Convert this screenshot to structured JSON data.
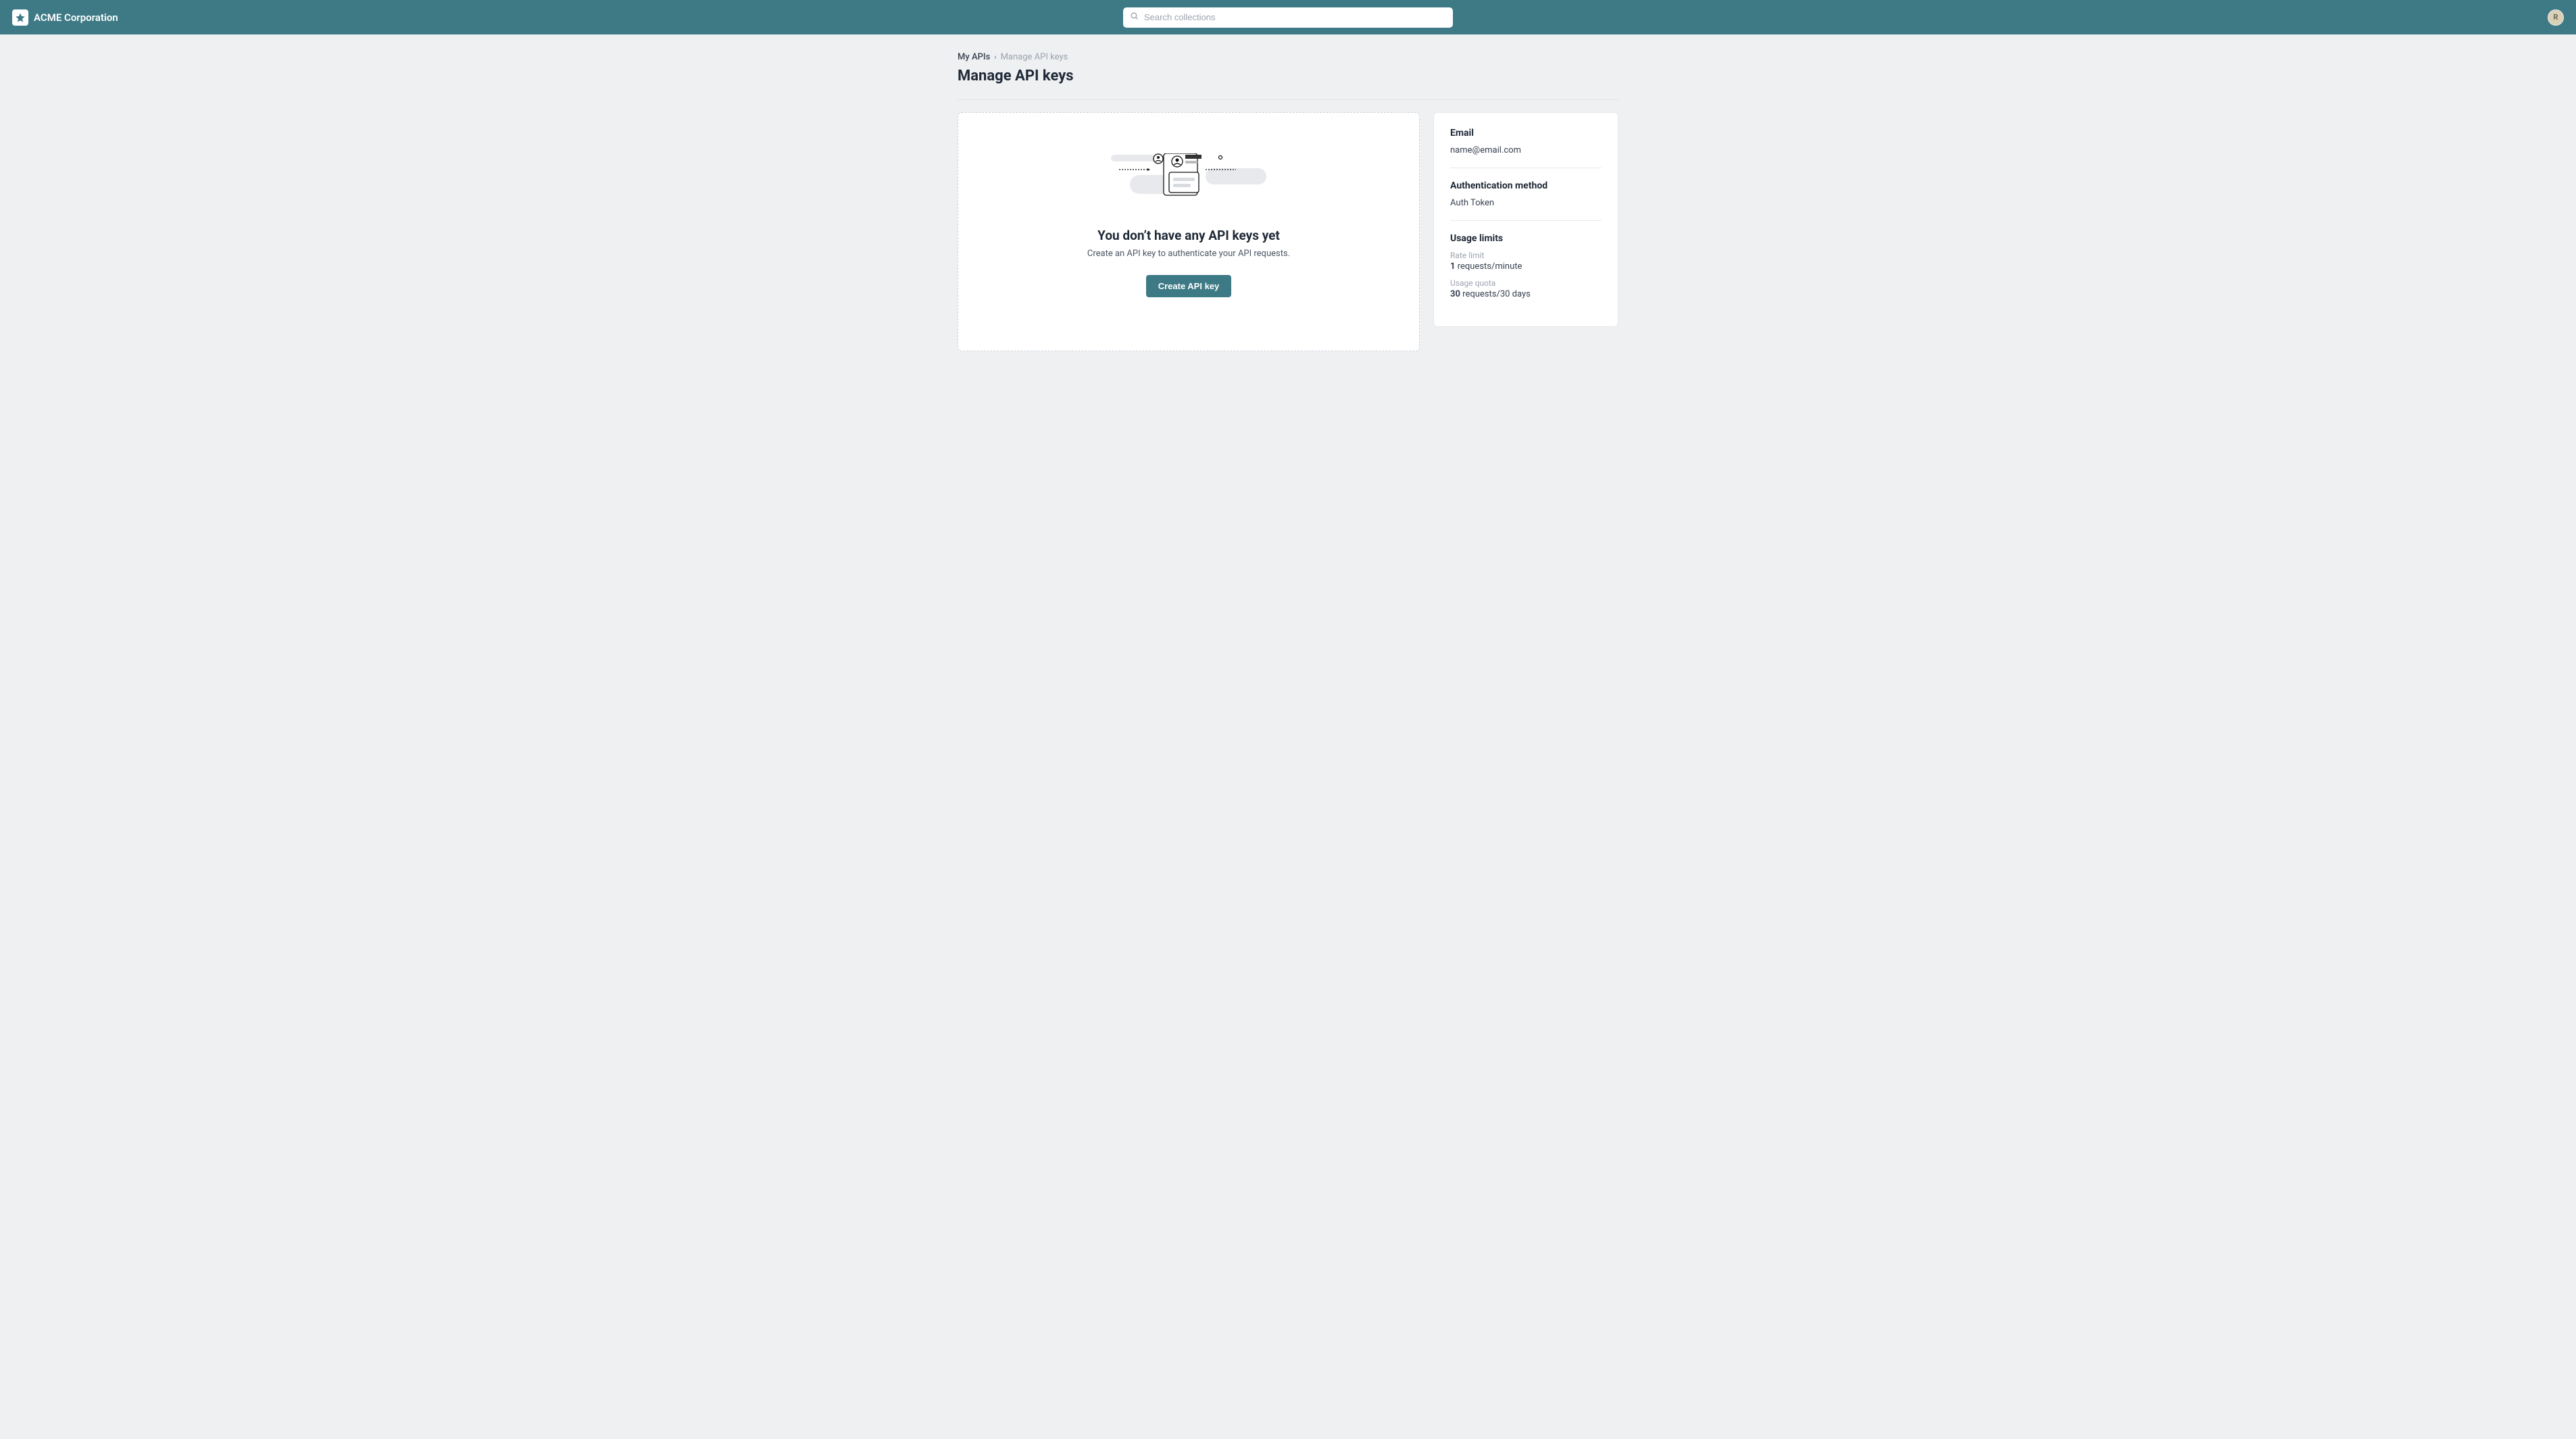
{
  "header": {
    "brand": "ACME Corporation",
    "search_placeholder": "Search collections",
    "avatar_initial": "R"
  },
  "breadcrumb": {
    "parent": "My APIs",
    "current": "Manage API keys"
  },
  "page": {
    "title": "Manage API keys"
  },
  "empty_state": {
    "title": "You don’t have any API keys yet",
    "subtitle": "Create an API key to authenticate your API requests.",
    "button": "Create API key"
  },
  "sidebar": {
    "email": {
      "heading": "Email",
      "value": "name@email.com"
    },
    "auth": {
      "heading": "Authentication method",
      "value": "Auth Token"
    },
    "usage": {
      "heading": "Usage limits",
      "rate_limit_label": "Rate limit",
      "rate_limit_value": "1",
      "rate_limit_unit": "requests/minute",
      "quota_label": "Usage quota",
      "quota_value": "30",
      "quota_unit": "requests/30 days"
    }
  }
}
